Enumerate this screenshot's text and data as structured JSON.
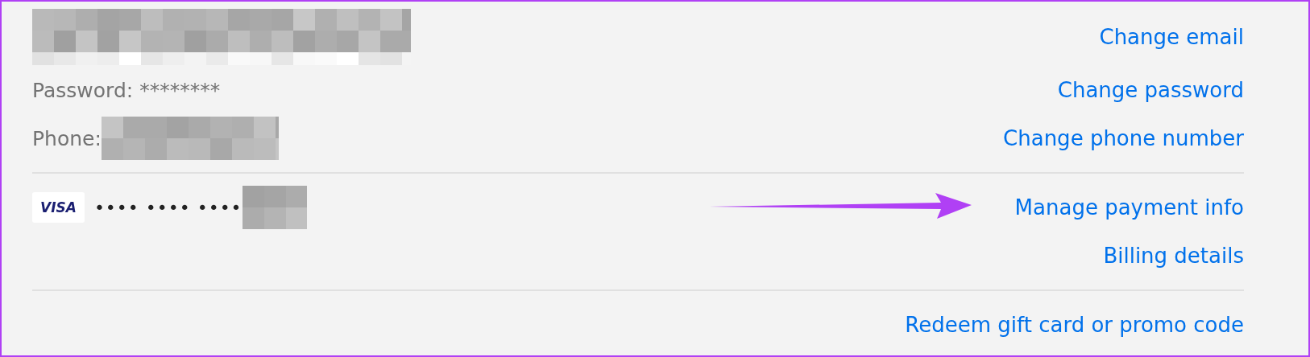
{
  "sections": [
    {
      "rows": [
        {
          "kind": "redacted",
          "link": "Change email"
        },
        {
          "kind": "text",
          "label": "Password:",
          "value": "********",
          "link": "Change password"
        },
        {
          "kind": "redacted_value",
          "label": "Phone:",
          "link": "Change phone number"
        }
      ]
    },
    {
      "rows": [
        {
          "kind": "card",
          "card_brand": "VISA",
          "masked": "•••• •••• ••••",
          "link": "Manage payment info",
          "annotation_arrow": true
        },
        {
          "kind": "empty",
          "link": "Billing details"
        }
      ]
    },
    {
      "rows": [
        {
          "kind": "empty",
          "link": "Redeem gift card or promo code"
        }
      ]
    }
  ]
}
